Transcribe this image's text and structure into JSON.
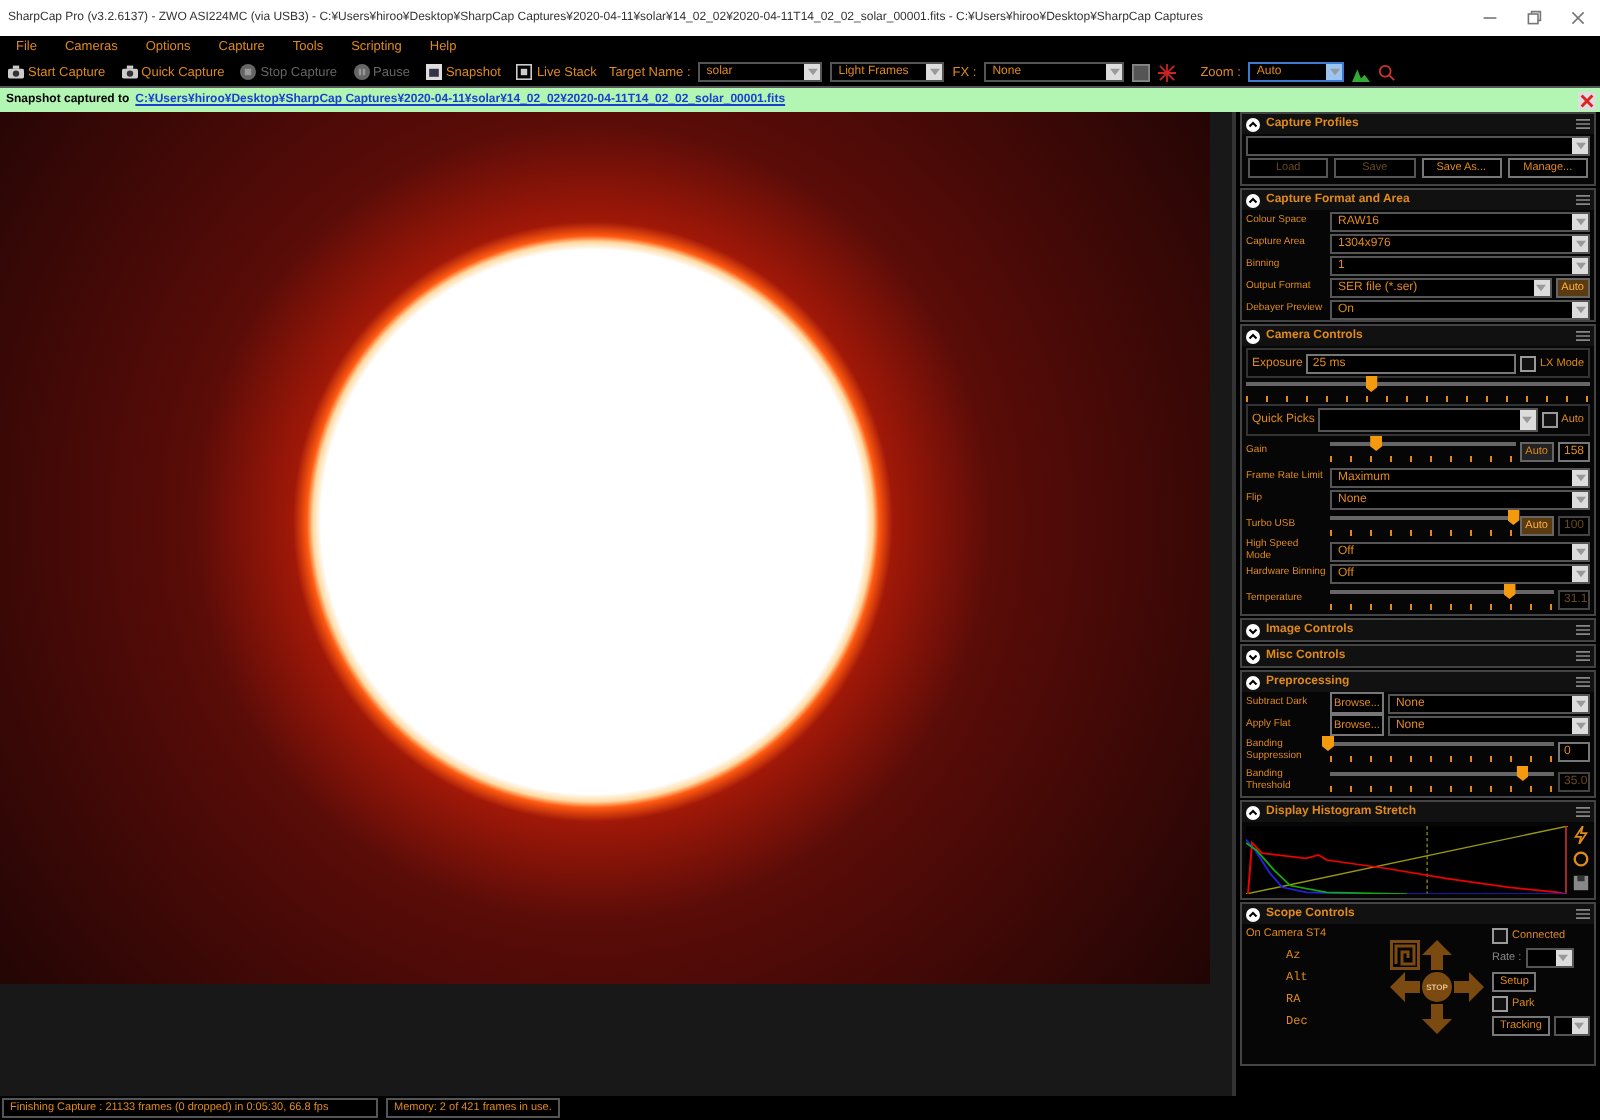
{
  "window": {
    "title": "SharpCap Pro (v3.2.6137) - ZWO ASI224MC (via USB3) - C:¥Users¥hiroo¥Desktop¥SharpCap Captures¥2020-04-11¥solar¥14_02_02¥2020-04-11T14_02_02_solar_00001.fits - C:¥Users¥hiroo¥Desktop¥SharpCap Captures"
  },
  "menu": [
    "File",
    "Cameras",
    "Options",
    "Capture",
    "Tools",
    "Scripting",
    "Help"
  ],
  "toolbar": [
    {
      "label": "Start Capture",
      "disabled": false
    },
    {
      "label": "Quick Capture",
      "disabled": false
    },
    {
      "label": "Stop Capture",
      "disabled": true
    },
    {
      "label": "Pause",
      "disabled": true
    },
    {
      "label": "Snapshot",
      "disabled": false
    },
    {
      "label": "Live Stack",
      "disabled": false
    }
  ],
  "target_name": {
    "label": "Target Name :",
    "value": "solar"
  },
  "frame_type": {
    "value": "Light Frames"
  },
  "fx": {
    "label": "FX :",
    "value": "None"
  },
  "zoom": {
    "label": "Zoom :",
    "value": "Auto"
  },
  "notification": {
    "text": "Snapshot captured to",
    "link": "C:¥Users¥hiroo¥Desktop¥SharpCap Captures¥2020-04-11¥solar¥14_02_02¥2020-04-11T14_02_02_solar_00001.fits"
  },
  "sections": [
    {
      "title": "Capture Profiles",
      "expanded": true,
      "kind": "profiles",
      "buttons": [
        {
          "label": "Load",
          "disabled": true
        },
        {
          "label": "Save",
          "disabled": true
        },
        {
          "label": "Save As...",
          "disabled": false
        },
        {
          "label": "Manage...",
          "disabled": false
        }
      ]
    },
    {
      "title": "Capture Format and Area",
      "expanded": true,
      "kind": "rows",
      "rows": [
        {
          "kind": "select",
          "label": "Colour Space",
          "value": "RAW16"
        },
        {
          "kind": "select",
          "label": "Capture Area",
          "value": "1304x976"
        },
        {
          "kind": "select",
          "label": "Binning",
          "value": "1"
        },
        {
          "kind": "select",
          "label": "Output Format",
          "value": "SER file (*.ser)",
          "auto": {
            "label": "Auto",
            "selected": true
          }
        },
        {
          "kind": "select",
          "label": "Debayer Preview",
          "value": "On"
        }
      ]
    },
    {
      "title": "Camera Controls",
      "expanded": true,
      "kind": "rows",
      "rows": [
        {
          "kind": "exposure",
          "label": "Exposure",
          "value": "25 ms",
          "check": {
            "label": "LX Mode",
            "checked": false
          },
          "level": 0.37
        },
        {
          "kind": "quick_picks",
          "label": "Quick Picks",
          "check": {
            "label": "Auto",
            "checked": false
          }
        },
        {
          "kind": "slider",
          "label": "Gain",
          "level": 0.26,
          "auto": {
            "label": "Auto",
            "selected": false
          },
          "reading": "158",
          "reading_disabled": false
        },
        {
          "kind": "select",
          "label": "Frame Rate Limit",
          "value": "Maximum"
        },
        {
          "kind": "select",
          "label": "Flip",
          "value": "None"
        },
        {
          "kind": "slider",
          "label": "Turbo USB",
          "level": 1,
          "auto": {
            "label": "Auto",
            "selected": true
          },
          "reading": "100",
          "reading_disabled": true
        },
        {
          "kind": "select",
          "label": "High Speed Mode",
          "value": "Off"
        },
        {
          "kind": "select",
          "label": "Hardware Binning",
          "value": "Off"
        },
        {
          "kind": "slider",
          "label": "Temperature",
          "level": 0.81,
          "reading": "31.1",
          "reading_disabled": true
        }
      ]
    },
    {
      "title": "Image Controls",
      "expanded": false
    },
    {
      "title": "Misc Controls",
      "expanded": false
    },
    {
      "title": "Preprocessing",
      "expanded": true,
      "kind": "rows",
      "rows": [
        {
          "kind": "browse",
          "label": "Subtract Dark",
          "button": "Browse...",
          "value": "None"
        },
        {
          "kind": "browse",
          "label": "Apply Flat",
          "button": "Browse...",
          "value": "None"
        },
        {
          "kind": "slider",
          "label": "Banding Suppression",
          "level": 0,
          "reading": "0",
          "reading_disabled": false
        },
        {
          "kind": "slider",
          "label": "Banding Threshold",
          "level": 0.87,
          "reading": "35.0",
          "reading_disabled": true
        }
      ]
    },
    {
      "title": "Display Histogram Stretch",
      "expanded": true,
      "kind": "histogram"
    },
    {
      "title": "Scope Controls",
      "expanded": true,
      "kind": "scope",
      "source": "On Camera ST4",
      "connected": {
        "label": "Connected",
        "checked": false
      },
      "rate_label": "Rate :",
      "axes": [
        "Az",
        "Alt",
        "RA",
        "Dec"
      ],
      "stop": "STOP",
      "setup": "Setup",
      "park": {
        "label": "Park",
        "checked": false
      },
      "tracking": "Tracking"
    }
  ],
  "status_bar": {
    "message": "Finishing Capture : 21133 frames (0 dropped) in 0:05:30, 66.8 fps",
    "memory": "Memory: 2 of 421 frames in use."
  }
}
